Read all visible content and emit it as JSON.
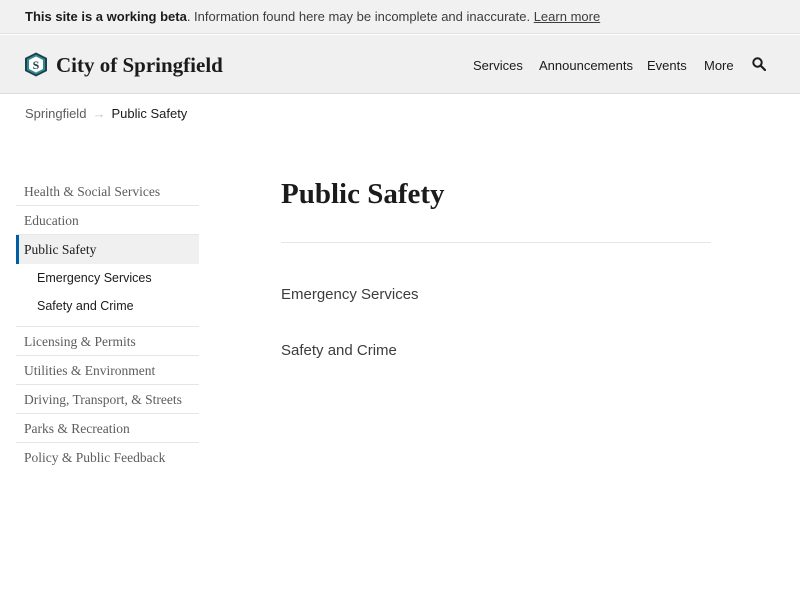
{
  "banner": {
    "bold_text": "This site is a working beta",
    "text": ". Information found here may be incomplete and inaccurate. ",
    "link": "Learn more"
  },
  "header": {
    "title": "City of Springfield",
    "logo_icon": "city-seal-icon",
    "nav": [
      "Services",
      "Announcements",
      "Events",
      "More"
    ],
    "search_icon": "search-icon"
  },
  "breadcrumb": {
    "home": "Springfield",
    "separator": "→",
    "current": "Public Safety"
  },
  "sidenav": {
    "items_before": [
      "Health & Social Services",
      "Education"
    ],
    "active": "Public Safety",
    "sub_items": [
      "Emergency Services",
      "Safety and Crime"
    ],
    "items_after": [
      "Licensing & Permits",
      "Utilities & Environment",
      "Driving, Transport, & Streets",
      "Parks & Recreation",
      "Policy & Public Feedback"
    ]
  },
  "main": {
    "title": "Public Safety",
    "links": [
      "Emergency Services",
      "Safety and Crime"
    ]
  },
  "colors": {
    "accent": "#005ea2",
    "banner_bg": "#f1f1f1",
    "header_bg": "#f0f0f0"
  }
}
